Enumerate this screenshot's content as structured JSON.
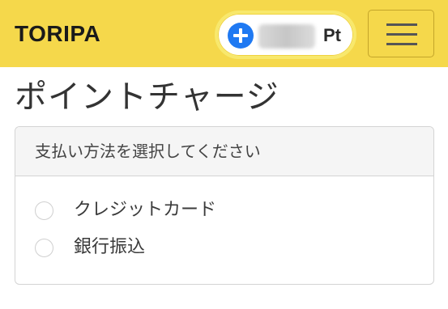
{
  "header": {
    "brand": "TORIPA",
    "points": {
      "value": "",
      "unit": "Pt",
      "add_icon": "plus-circle-icon"
    },
    "menu_icon": "hamburger-menu-icon",
    "colors": {
      "background": "#f5d84b",
      "accent": "#1f79f2"
    }
  },
  "main": {
    "title": "ポイントチャージ",
    "payment_card": {
      "header": "支払い方法を選択してください",
      "options": [
        {
          "label": "クレジットカード",
          "selected": false
        },
        {
          "label": "銀行振込",
          "selected": false
        }
      ]
    }
  }
}
